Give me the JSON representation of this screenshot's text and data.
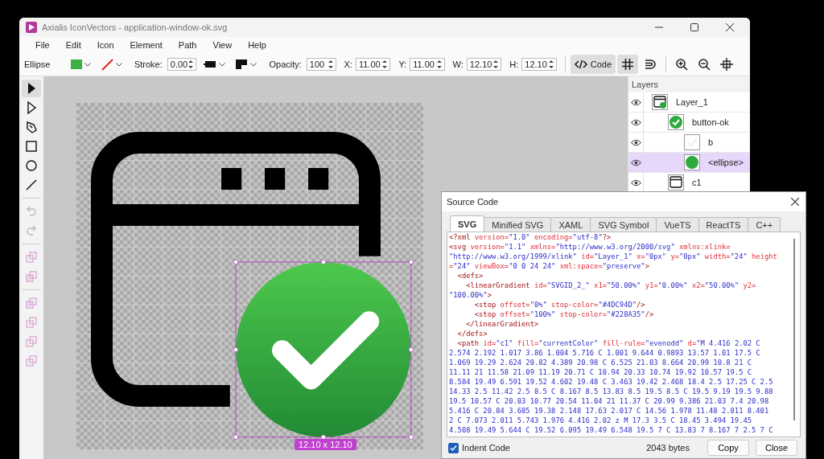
{
  "window": {
    "title": "Axialis IconVectors - application-window-ok.svg"
  },
  "menu": [
    {
      "label": "File"
    },
    {
      "label": "Edit"
    },
    {
      "label": "Icon"
    },
    {
      "label": "Element"
    },
    {
      "label": "Path"
    },
    {
      "label": "View"
    },
    {
      "label": "Help"
    }
  ],
  "toolbar": {
    "element": "Ellipse",
    "stroke_label": "Stroke:",
    "stroke": "0.00",
    "opacity_label": "Opacity:",
    "opacity": "100",
    "coords": [
      {
        "label": "X:",
        "value": "11.00"
      },
      {
        "label": "Y:",
        "value": "11.00"
      },
      {
        "label": "W:",
        "value": "12.10"
      },
      {
        "label": "H:",
        "value": "12.10"
      }
    ],
    "view_tools": [
      {
        "kind": "code",
        "label": "Code",
        "selected": true
      },
      {
        "kind": "grid",
        "selected": true
      },
      {
        "kind": "magnet",
        "selected": false
      },
      {
        "kind": "zoom-in",
        "selected": false
      },
      {
        "kind": "zoom-out",
        "selected": false
      },
      {
        "kind": "fit",
        "selected": false
      }
    ]
  },
  "tools": [
    {
      "kind": "select",
      "selected": true,
      "disabled": false
    },
    {
      "kind": "direct-select",
      "selected": false,
      "disabled": false
    },
    {
      "kind": "pen",
      "selected": false,
      "disabled": false
    },
    {
      "kind": "rect",
      "selected": false,
      "disabled": false
    },
    {
      "kind": "ellipse",
      "selected": false,
      "disabled": false
    },
    {
      "kind": "line",
      "selected": false,
      "disabled": false
    },
    {
      "kind": "separator"
    },
    {
      "kind": "undo",
      "selected": false,
      "disabled": true
    },
    {
      "kind": "redo",
      "selected": false,
      "disabled": true
    },
    {
      "kind": "separator"
    },
    {
      "kind": "union",
      "selected": false,
      "disabled": true
    },
    {
      "kind": "subtract",
      "selected": false,
      "disabled": true
    },
    {
      "kind": "separator"
    },
    {
      "kind": "intersect",
      "selected": false,
      "disabled": true
    },
    {
      "kind": "exclude",
      "selected": false,
      "disabled": true
    },
    {
      "kind": "divide",
      "selected": false,
      "disabled": true
    },
    {
      "kind": "merge",
      "selected": false,
      "disabled": true
    }
  ],
  "canvas": {
    "selection_size": "12.10 x 12.10"
  },
  "layers": {
    "title": "Layers",
    "items": [
      {
        "name": "Layer_1",
        "kind": "layer",
        "visible": true,
        "selected": false,
        "children": [
          {
            "name": "button-ok",
            "kind": "group",
            "visible": true,
            "selected": false,
            "children": [
              {
                "name": "b",
                "kind": "check",
                "visible": true,
                "selected": false
              },
              {
                "name": "<ellipse>",
                "kind": "ellipse",
                "visible": true,
                "selected": true
              }
            ]
          },
          {
            "name": "c1",
            "kind": "window",
            "visible": true,
            "selected": false
          }
        ]
      }
    ]
  },
  "dialog": {
    "title": "Source Code",
    "tabs": [
      {
        "label": "SVG",
        "selected": true
      },
      {
        "label": "Minified SVG",
        "selected": false
      },
      {
        "label": "XAML",
        "selected": false
      },
      {
        "label": "SVG Symbol",
        "selected": false
      },
      {
        "label": "VueTS",
        "selected": false
      },
      {
        "label": "ReactTS",
        "selected": false
      },
      {
        "label": "C++",
        "selected": false
      }
    ],
    "code_lines": [
      [
        {
          "kind": "tag",
          "text": "<?xml "
        },
        {
          "kind": "attr",
          "text": "version="
        },
        {
          "kind": "value",
          "text": "\"1.0\""
        },
        {
          "kind": "attr",
          "text": " encoding="
        },
        {
          "kind": "value",
          "text": "\"utf-8\""
        },
        {
          "kind": "tag",
          "text": "?>"
        }
      ],
      [
        {
          "kind": "tag",
          "text": "<svg "
        },
        {
          "kind": "attr",
          "text": "version="
        },
        {
          "kind": "value",
          "text": "\"1.1\""
        },
        {
          "kind": "attr",
          "text": " xmlns="
        },
        {
          "kind": "value",
          "text": "\"http://www.w3.org/2000/svg\""
        },
        {
          "kind": "attr",
          "text": " xmlns:xlink="
        }
      ],
      [
        {
          "kind": "value",
          "text": "\"http://www.w3.org/1999/xlink\""
        },
        {
          "kind": "attr",
          "text": " id="
        },
        {
          "kind": "value",
          "text": "\"Layer_1\""
        },
        {
          "kind": "attr",
          "text": " x="
        },
        {
          "kind": "value",
          "text": "\"0px\""
        },
        {
          "kind": "attr",
          "text": " y="
        },
        {
          "kind": "value",
          "text": "\"0px\""
        },
        {
          "kind": "attr",
          "text": " width="
        },
        {
          "kind": "value",
          "text": "\"24\""
        },
        {
          "kind": "attr",
          "text": " height"
        }
      ],
      [
        {
          "kind": "attr",
          "text": "="
        },
        {
          "kind": "value",
          "text": "\"24\""
        },
        {
          "kind": "attr",
          "text": " viewBox="
        },
        {
          "kind": "value",
          "text": "\"0 0 24 24\""
        },
        {
          "kind": "attr",
          "text": " xml:space="
        },
        {
          "kind": "value",
          "text": "\"preserve\""
        },
        {
          "kind": "tag",
          "text": ">"
        }
      ],
      [
        {
          "kind": "tag",
          "text": "  <defs>"
        }
      ],
      [
        {
          "kind": "tag",
          "text": "    <linearGradient "
        },
        {
          "kind": "attr",
          "text": "id="
        },
        {
          "kind": "value",
          "text": "\"SVGID_2_\""
        },
        {
          "kind": "attr",
          "text": " x1="
        },
        {
          "kind": "value",
          "text": "\"50.00%\""
        },
        {
          "kind": "attr",
          "text": " y1="
        },
        {
          "kind": "value",
          "text": "\"0.00%\""
        },
        {
          "kind": "attr",
          "text": " x2="
        },
        {
          "kind": "value",
          "text": "\"50.00%\""
        },
        {
          "kind": "attr",
          "text": " y2="
        }
      ],
      [
        {
          "kind": "value",
          "text": "\"100.00%\""
        },
        {
          "kind": "tag",
          "text": ">"
        }
      ],
      [
        {
          "kind": "tag",
          "text": "      <stop "
        },
        {
          "kind": "attr",
          "text": "offset="
        },
        {
          "kind": "value",
          "text": "\"0%\""
        },
        {
          "kind": "attr",
          "text": " stop-color="
        },
        {
          "kind": "value",
          "text": "\"#4DC94D\""
        },
        {
          "kind": "tag",
          "text": "/>"
        }
      ],
      [
        {
          "kind": "tag",
          "text": "      <stop "
        },
        {
          "kind": "attr",
          "text": "offset="
        },
        {
          "kind": "value",
          "text": "\"100%\""
        },
        {
          "kind": "attr",
          "text": " stop-color="
        },
        {
          "kind": "value",
          "text": "\"#228A35\""
        },
        {
          "kind": "tag",
          "text": "/>"
        }
      ],
      [
        {
          "kind": "tag",
          "text": "    </linearGradient>"
        }
      ],
      [
        {
          "kind": "tag",
          "text": "  </defs>"
        }
      ],
      [
        {
          "kind": "tag",
          "text": "  <path "
        },
        {
          "kind": "attr",
          "text": "id="
        },
        {
          "kind": "value",
          "text": "\"c1\""
        },
        {
          "kind": "attr",
          "text": " fill="
        },
        {
          "kind": "value",
          "text": "\"currentColor\""
        },
        {
          "kind": "attr",
          "text": " fill-rule="
        },
        {
          "kind": "value",
          "text": "\"evenodd\""
        },
        {
          "kind": "attr",
          "text": " d="
        },
        {
          "kind": "value",
          "text": "\"M 4.416 2.02 C"
        }
      ],
      [
        {
          "kind": "value",
          "text": "2.574 2.192 1.017 3.86 1.004 5.716 C 1.001 9.644 0.9893 13.57 1.01 17.5 C"
        }
      ],
      [
        {
          "kind": "value",
          "text": "1.069 19.29 2.624 20.82 4.389 20.98 C 6.525 21.03 8.664 20.99 10.8 21 C"
        }
      ],
      [
        {
          "kind": "value",
          "text": "11.11 21 11.58 21.09 11.19 20.71 C 10.94 20.33 10.74 19.92 10.57 19.5 C"
        }
      ],
      [
        {
          "kind": "value",
          "text": "8.584 19.49 6.591 19.52 4.602 19.48 C 3.463 19.42 2.468 18.4 2.5 17.25 C 2.5"
        }
      ],
      [
        {
          "kind": "value",
          "text": "14.33 2.5 11.42 2.5 8.5 C 8.167 8.5 13.83 8.5 19.5 8.5 C 19.5 9.19 19.5 9.88"
        }
      ],
      [
        {
          "kind": "value",
          "text": "19.5 10.57 C 20.03 10.77 20.54 11.04 21 11.37 C 20.99 9.386 21.03 7.4 20.98"
        }
      ],
      [
        {
          "kind": "value",
          "text": "5.416 C 20.84 3.685 19.38 2.148 17.63 2.017 C 14.56 1.978 11.48 2.011 8.401"
        }
      ],
      [
        {
          "kind": "value",
          "text": "2 C 7.073 2.011 5.743 1.976 4.416 2.02 z M 17.3 3.5 C 18.45 3.494 19.45"
        }
      ],
      [
        {
          "kind": "value",
          "text": "4.508 19.49 5.644 C 19.52 6.095 19.49 6.548 19.5 7 C 13.83 7 8.167 7 2.5 7 C"
        }
      ]
    ],
    "indent_code": {
      "label": "Indent Code",
      "checked": true
    },
    "size": "2043 bytes",
    "buttons": [
      "Copy",
      "Close"
    ]
  }
}
